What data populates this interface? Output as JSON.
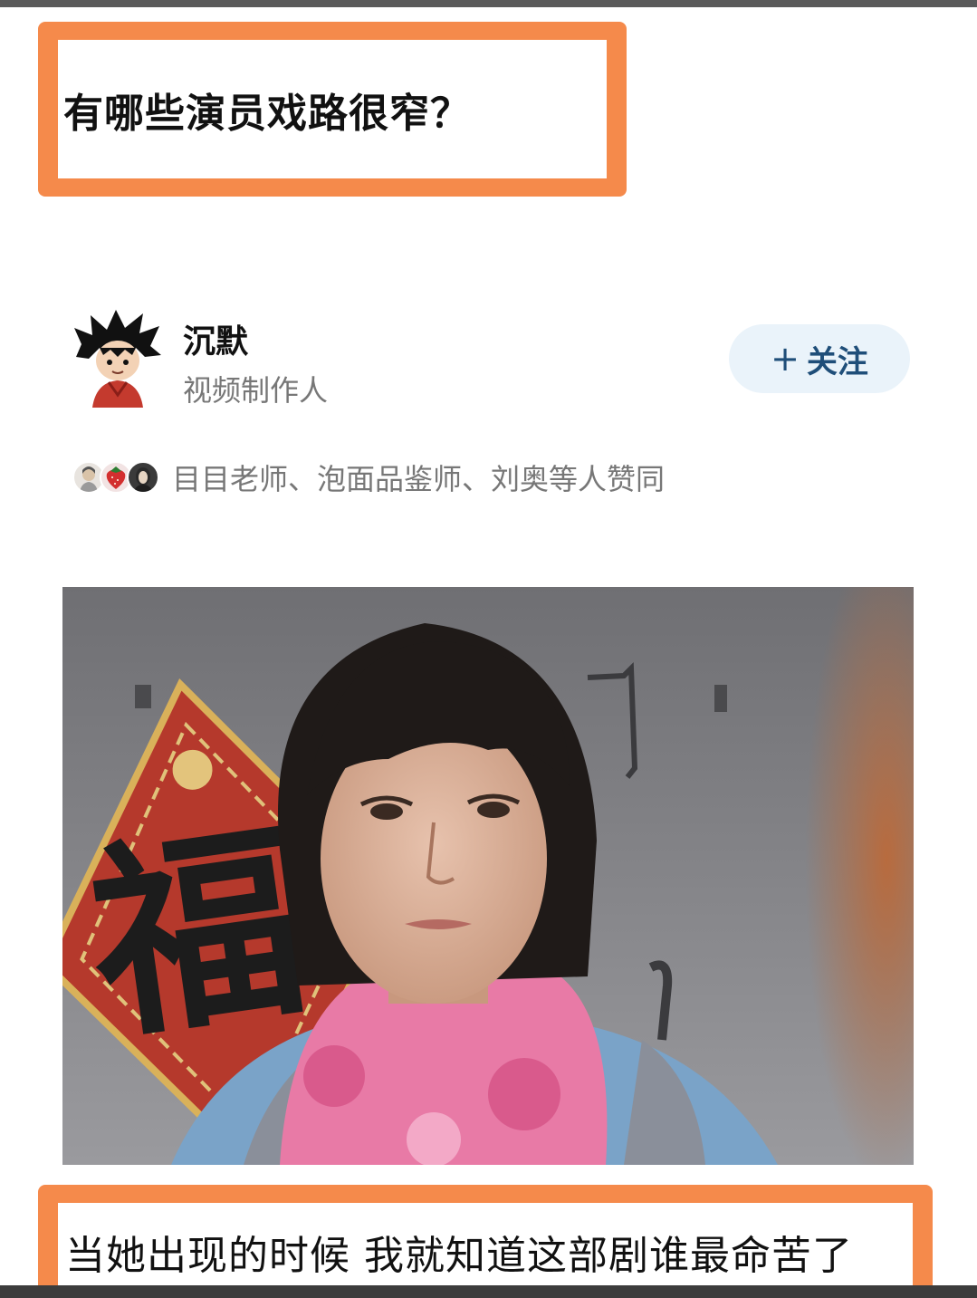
{
  "question": {
    "title": "有哪些演员戏路很窄？"
  },
  "author": {
    "name": "沉默",
    "title": "视频制作人",
    "avatar_icon": "cartoon-boy-avatar-icon"
  },
  "follow_button": {
    "plus": "+",
    "label": "关注"
  },
  "likes": {
    "text": "目目老师、泡面品鉴师、刘奥等人赞同",
    "avatar_icons": [
      "user-avatar-icon",
      "strawberry-avatar-icon",
      "portrait-avatar-icon"
    ]
  },
  "scene": {
    "image_icon": "drama-still-image",
    "fu_character": "福"
  },
  "caption": {
    "text": "当她出现的时候 我就知道这部剧谁最命苦了"
  },
  "colors": {
    "accent_frame": "#f58a4b",
    "follow_bg": "#eaf3fa",
    "follow_text": "#1f4e79",
    "muted_text": "#777777"
  }
}
